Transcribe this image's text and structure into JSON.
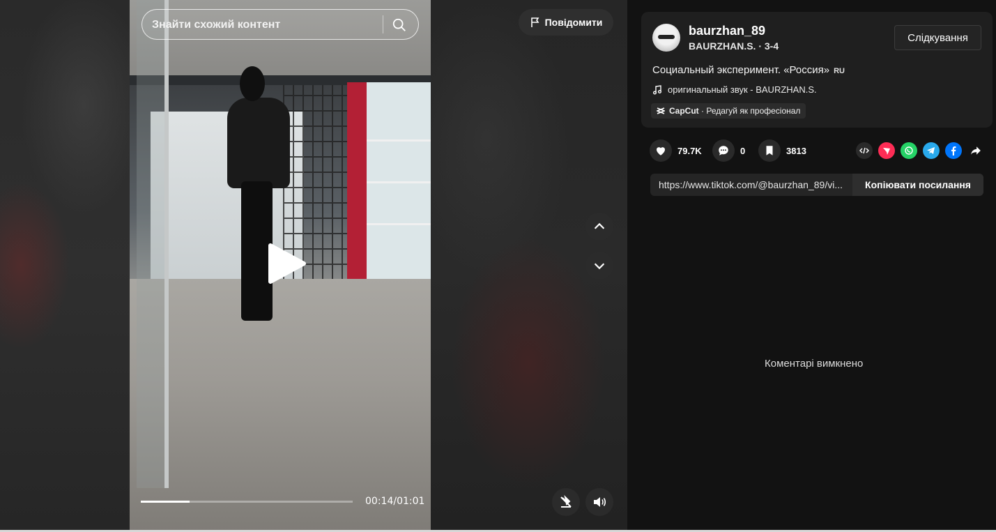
{
  "search": {
    "placeholder_text": "Знайти схожий контент",
    "icon": "search-icon"
  },
  "report": {
    "label": "Повідомити",
    "icon": "flag-icon"
  },
  "player": {
    "time": "00:14/01:01",
    "progress_fraction": 0.23,
    "state": "paused",
    "controls": [
      "play-icon",
      "chevron-up-icon",
      "chevron-down-icon",
      "floating-player-icon",
      "volume-icon"
    ]
  },
  "author": {
    "username": "baurzhan_89",
    "subline": "BAURZHAN.S. · 3-4",
    "follow_label": "Слідкування"
  },
  "post": {
    "description": "Социальный эксперимент. «Россия»",
    "lang_badge": "RU",
    "music": "оригинальный звук - BAURZHAN.S.",
    "capcut_brand": "CapCut",
    "capcut_text": " · Редагуй як професіонал"
  },
  "stats": {
    "likes": "79.7K",
    "comments": "0",
    "saves": "3813"
  },
  "share": {
    "targets": [
      "embed-icon",
      "repost-icon",
      "whatsapp-icon",
      "telegram-icon",
      "facebook-icon",
      "share-icon"
    ],
    "colors": {
      "repost": "#fe2c55",
      "whatsapp": "#25d366",
      "telegram": "#29a9eb",
      "facebook": "#0075fa"
    }
  },
  "link": {
    "url": "https://www.tiktok.com/@baurzhan_89/vi...",
    "copy_label": "Копіювати посилання"
  },
  "comments": {
    "disabled_text": "Коментарі вимкнено"
  }
}
